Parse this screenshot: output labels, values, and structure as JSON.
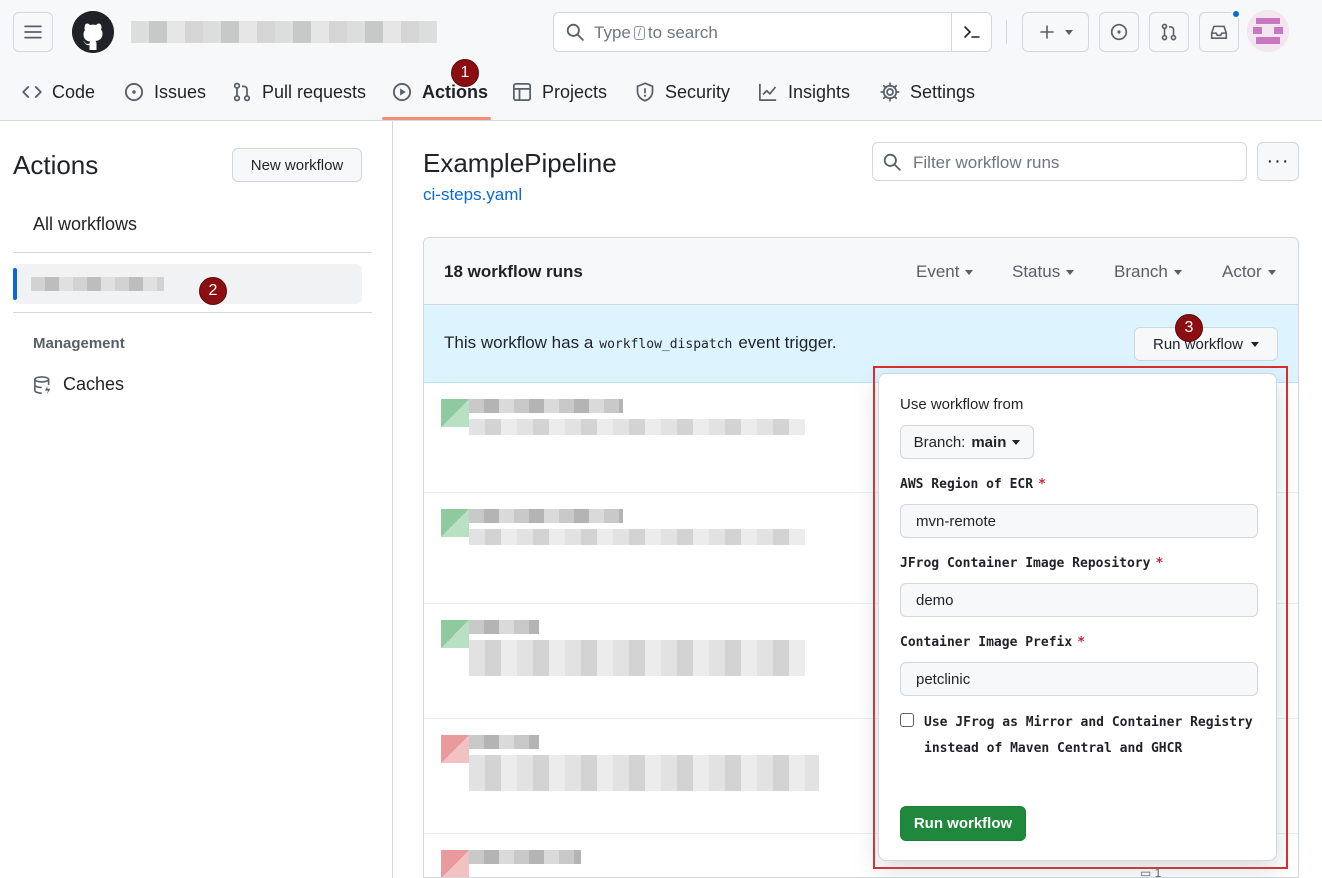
{
  "header": {
    "search_placeholder_pre": "Type",
    "search_slash": "/",
    "search_placeholder_post": "to search"
  },
  "repo_nav": {
    "code": "Code",
    "issues": "Issues",
    "pull_requests": "Pull requests",
    "actions": "Actions",
    "projects": "Projects",
    "security": "Security",
    "insights": "Insights",
    "settings": "Settings"
  },
  "markers": {
    "m1": "1",
    "m2": "2",
    "m3": "3"
  },
  "sidebar": {
    "title": "Actions",
    "new_workflow": "New workflow",
    "all_workflows": "All workflows",
    "management": "Management",
    "caches": "Caches"
  },
  "main": {
    "workflow_title": "ExamplePipeline",
    "workflow_file": "ci-steps.yaml",
    "filter_placeholder": "Filter workflow runs",
    "runs_count": "18 workflow runs",
    "filters": {
      "event": "Event",
      "status": "Status",
      "branch": "Branch",
      "actor": "Actor"
    },
    "dispatch_pre": "This workflow has a",
    "dispatch_code": "workflow_dispatch",
    "dispatch_post": "event trigger.",
    "run_workflow": "Run workflow",
    "runs": [
      {
        "status": "success"
      },
      {
        "status": "success"
      },
      {
        "status": "success"
      },
      {
        "status": "failure"
      },
      {
        "status": "failure"
      }
    ]
  },
  "popup": {
    "use_from": "Use workflow from",
    "branch_label": "Branch:",
    "branch_value": "main",
    "aws_label": "AWS Region of ECR",
    "aws_value": "mvn-remote",
    "jfrog_label": "JFrog Container Image Repository",
    "jfrog_value": "demo",
    "prefix_label": "Container Image Prefix",
    "prefix_value": "petclinic",
    "required_mark": "*",
    "checkbox_label": "Use JFrog as Mirror and Container Registry instead of Maven Central and GHCR",
    "run_button": "Run workflow"
  },
  "colors": {
    "accent": "#0969da",
    "success": "#1f883d",
    "highlight": "#d92b2b",
    "marker": "#8b0f12",
    "active_tab": "#fd8c73"
  }
}
